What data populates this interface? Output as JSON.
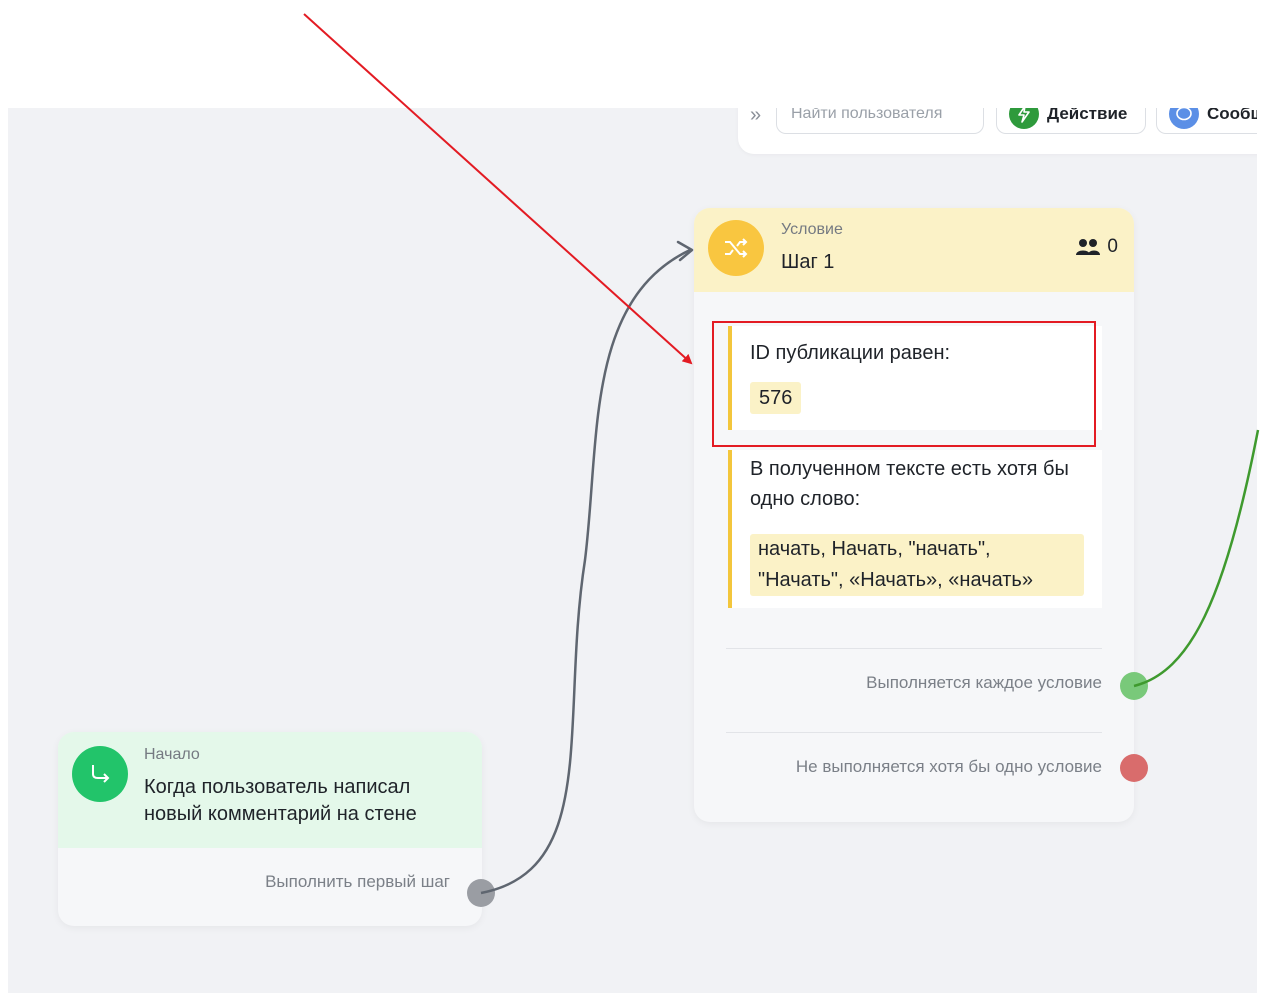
{
  "toolbar": {
    "expand_icon": "double-chevron-right-icon",
    "search_placeholder": "Найти пользователя",
    "action_label": "Действие",
    "message_label": "Сообщ"
  },
  "condition_node": {
    "category": "Условие",
    "title": "Шаг 1",
    "users_count": "0",
    "conditions": [
      {
        "label": "ID публикации равен:",
        "value": "576"
      },
      {
        "label": "В полученном тексте есть хотя бы одно слово:",
        "value": "начать, Начать, \"начать\", \"Начать\", «Начать», «начать»"
      }
    ],
    "outputs": {
      "success": "Выполняется каждое условие",
      "failure": "Не выполняется хотя бы одно условие"
    }
  },
  "start_node": {
    "category": "Начало",
    "title": "Когда пользователь написал новый комментарий на стене",
    "output": "Выполнить первый шаг"
  },
  "colors": {
    "annotation": "#e31b23",
    "condition_header": "#fbf2c7",
    "start_header": "#e4f8ea",
    "success_connector": "#3f9a2e",
    "flow_connector": "#5f6670"
  }
}
